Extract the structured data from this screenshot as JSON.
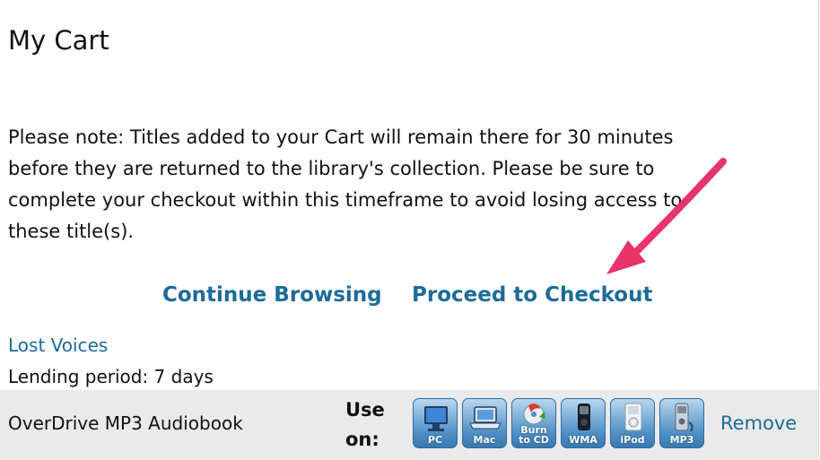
{
  "page": {
    "title": "My Cart"
  },
  "note": {
    "line1": "Please note: Titles added to your Cart will remain there for 30 minutes",
    "line2": "before they are returned to the library's collection. Please be sure to",
    "line3": "complete your checkout within this timeframe to avoid losing access to",
    "line4": "these title(s)."
  },
  "actions": {
    "continue_label": "Continue Browsing",
    "proceed_label": "Proceed to Checkout"
  },
  "cart_item": {
    "title": "Lost Voices",
    "lending_period": "Lending period: 7 days",
    "format": "OverDrive MP3 Audiobook",
    "use_on_line1": "Use",
    "use_on_line2": "on:",
    "devices": [
      {
        "label": "PC",
        "icon": "pc-icon"
      },
      {
        "label": "Mac",
        "icon": "mac-laptop-icon"
      },
      {
        "label": "Burn to CD",
        "line1": "Burn",
        "line2": "to CD",
        "icon": "burn-cd-icon"
      },
      {
        "label": "WMA",
        "icon": "wma-player-icon"
      },
      {
        "label": "iPod",
        "icon": "ipod-icon"
      },
      {
        "label": "MP3",
        "icon": "mp3-player-icon"
      }
    ],
    "remove_label": "Remove"
  },
  "colors": {
    "link": "#1c6b99",
    "annotation_arrow": "#e8336b",
    "format_row_bg": "#eaeaea"
  }
}
